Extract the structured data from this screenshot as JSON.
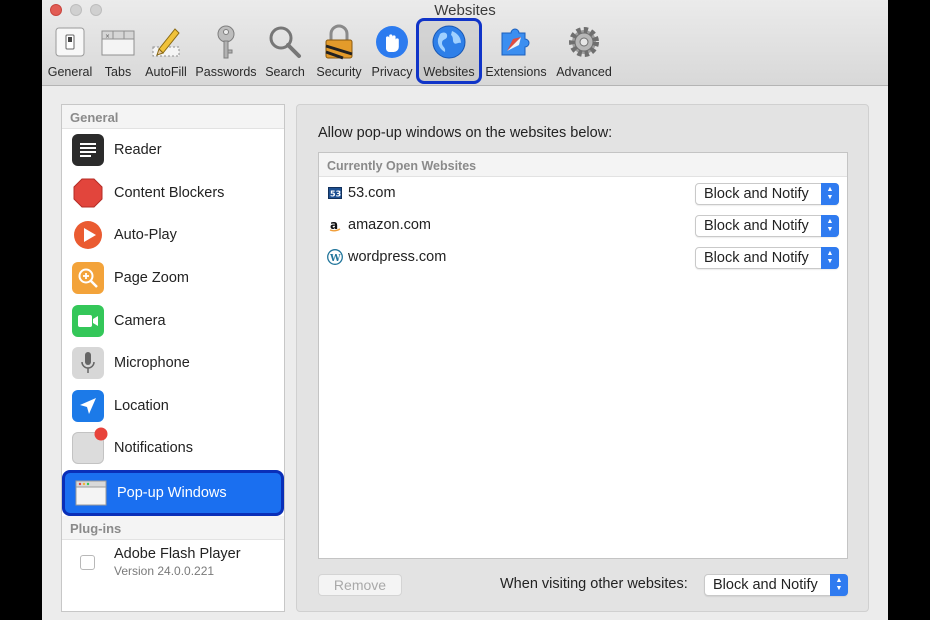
{
  "window": {
    "title": "Websites"
  },
  "toolbar": {
    "items": [
      {
        "label": "General",
        "icon": "general-switch-icon"
      },
      {
        "label": "Tabs",
        "icon": "tabs-icon"
      },
      {
        "label": "AutoFill",
        "icon": "autofill-pencil-icon"
      },
      {
        "label": "Passwords",
        "icon": "key-icon"
      },
      {
        "label": "Search",
        "icon": "magnifier-icon"
      },
      {
        "label": "Security",
        "icon": "padlock-icon"
      },
      {
        "label": "Privacy",
        "icon": "hand-icon"
      },
      {
        "label": "Websites",
        "icon": "globe-icon",
        "selected": true
      },
      {
        "label": "Extensions",
        "icon": "puzzle-icon"
      },
      {
        "label": "Advanced",
        "icon": "gear-icon"
      }
    ]
  },
  "sidebar": {
    "general_header": "General",
    "items": [
      {
        "label": "Reader",
        "icon": "reader-icon"
      },
      {
        "label": "Content Blockers",
        "icon": "stop-sign-icon"
      },
      {
        "label": "Auto-Play",
        "icon": "play-icon"
      },
      {
        "label": "Page Zoom",
        "icon": "zoom-icon"
      },
      {
        "label": "Camera",
        "icon": "camera-icon"
      },
      {
        "label": "Microphone",
        "icon": "microphone-icon"
      },
      {
        "label": "Location",
        "icon": "location-arrow-icon"
      },
      {
        "label": "Notifications",
        "icon": "notification-badge-icon"
      },
      {
        "label": "Pop-up Windows",
        "icon": "popup-window-icon",
        "selected": true
      }
    ],
    "plugins_header": "Plug-ins",
    "plugins": [
      {
        "name": "Adobe Flash Player",
        "version": "Version 24.0.0.221",
        "checked": false
      }
    ]
  },
  "main": {
    "allow_label": "Allow pop-up windows on the websites below:",
    "list_header": "Currently Open Websites",
    "sites": [
      {
        "domain": "53.com",
        "setting": "Block and Notify",
        "icon": "53-favicon-icon"
      },
      {
        "domain": "amazon.com",
        "setting": "Block and Notify",
        "icon": "amazon-favicon-icon"
      },
      {
        "domain": "wordpress.com",
        "setting": "Block and Notify",
        "icon": "wordpress-favicon-icon"
      }
    ],
    "remove_label": "Remove",
    "other_label": "When visiting other websites:",
    "other_setting": "Block and Notify"
  },
  "colors": {
    "selection_blue": "#1a6ff0",
    "highlight_outline": "#1034c8",
    "stepper_blue": "#2f7bf0"
  }
}
